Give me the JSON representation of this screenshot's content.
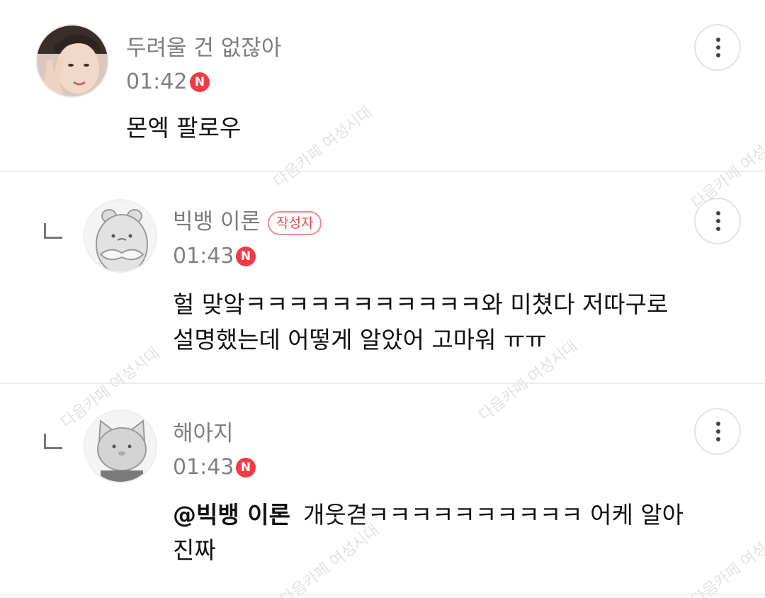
{
  "watermark": "다음카페 여성시대",
  "comments": [
    {
      "nickname": "두려울 건 없잖아",
      "time": "01:42",
      "new_badge": "N",
      "lines": [
        "몬엑 팔로우"
      ]
    },
    {
      "nickname": "빅뱅 이론",
      "author_badge": "작성자",
      "time": "01:43",
      "new_badge": "N",
      "lines": [
        "헐 맞앜ㅋㅋㅋㅋㅋㅋㅋㅋㅋㅋㅋ와 미쳤다 저따구로",
        "설명했는데 어떻게 알았어 고마워 ㅠㅠ"
      ]
    },
    {
      "nickname": "해아지",
      "time": "01:43",
      "new_badge": "N",
      "mention": "@빅뱅 이론",
      "lines": [
        "개웃겯ㅋㅋㅋㅋㅋㅋㅋㅋㅋㅋ 어케 알아",
        "진짜"
      ]
    }
  ],
  "icons": {
    "more": "more-vertical-icon",
    "reply": "reply-arrow-icon"
  },
  "colors": {
    "accent_red": "#ef3b47",
    "badge_border": "#f08a8d",
    "muted_text": "#7d7d7d"
  }
}
